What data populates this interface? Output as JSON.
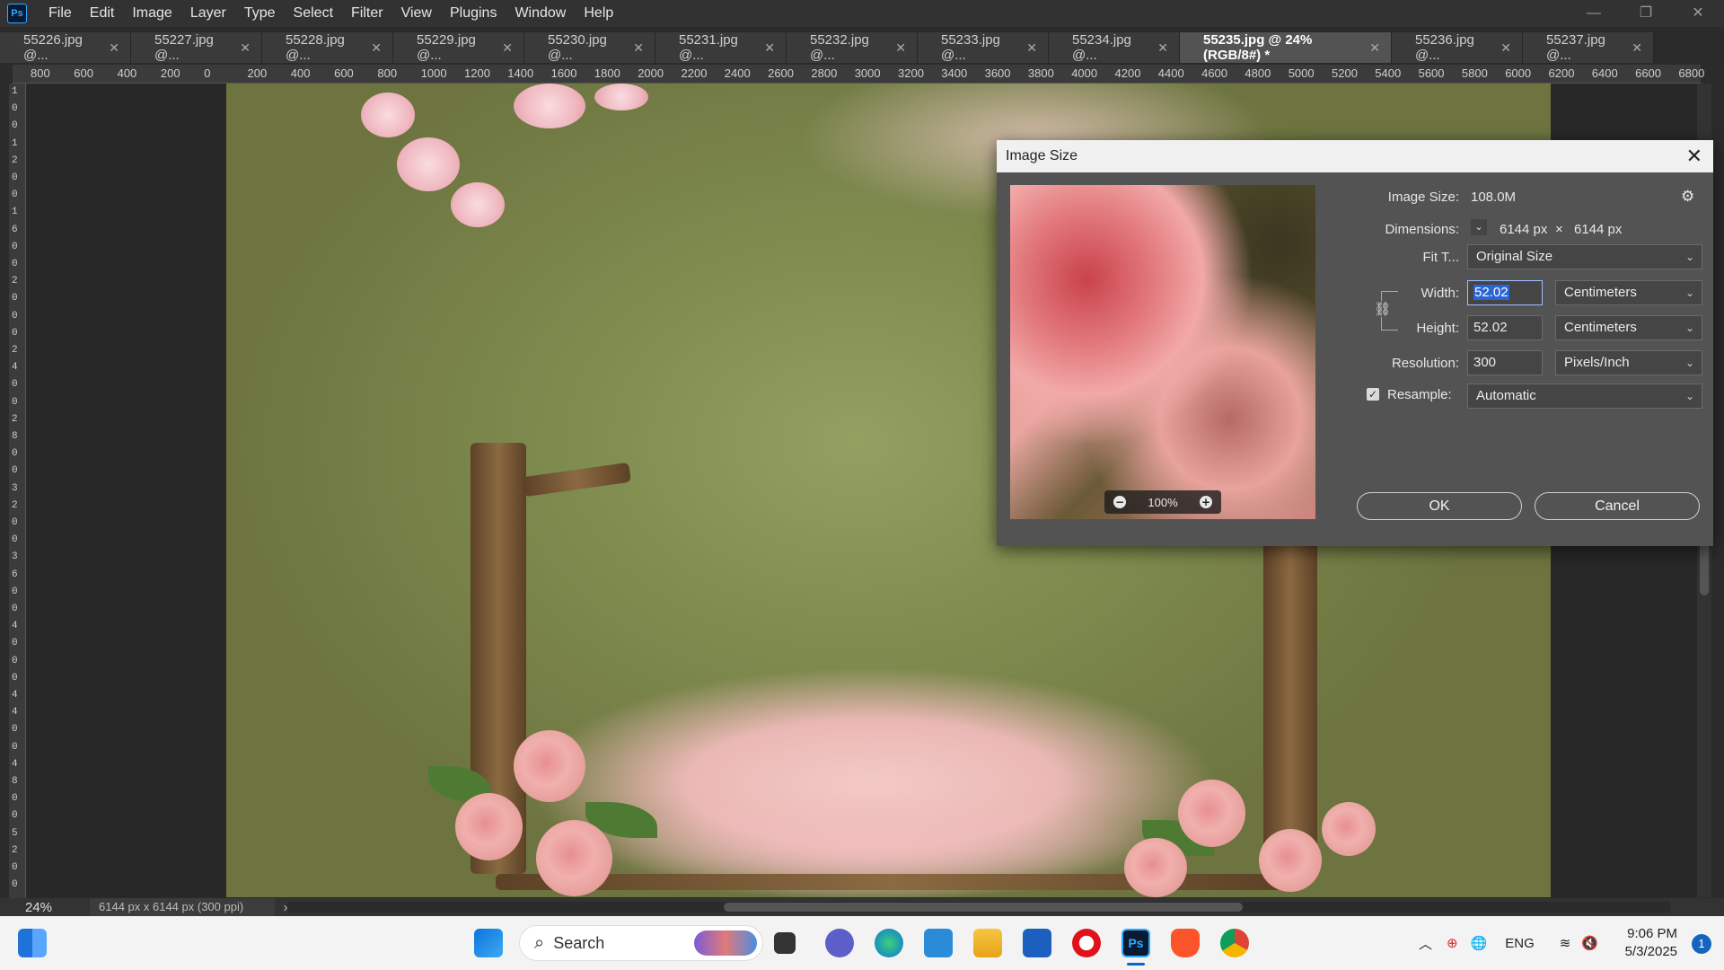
{
  "app": {
    "logo_text": "Ps",
    "menu": [
      "File",
      "Edit",
      "Image",
      "Layer",
      "Type",
      "Select",
      "Filter",
      "View",
      "Plugins",
      "Window",
      "Help"
    ],
    "window_controls": [
      "—",
      "❐",
      "✕"
    ]
  },
  "tabs": [
    {
      "label": "55226.jpg @...",
      "active": false
    },
    {
      "label": "55227.jpg @...",
      "active": false
    },
    {
      "label": "55228.jpg @...",
      "active": false
    },
    {
      "label": "55229.jpg @...",
      "active": false
    },
    {
      "label": "55230.jpg @...",
      "active": false
    },
    {
      "label": "55231.jpg @...",
      "active": false
    },
    {
      "label": "55232.jpg @...",
      "active": false
    },
    {
      "label": "55233.jpg @...",
      "active": false
    },
    {
      "label": "55234.jpg @...",
      "active": false
    },
    {
      "label": "55235.jpg @ 24% (RGB/8#) *",
      "active": true
    },
    {
      "label": "55236.jpg @...",
      "active": false
    },
    {
      "label": "55237.jpg @...",
      "active": false
    }
  ],
  "ruler": {
    "top_labels": [
      "800",
      "600",
      "400",
      "200",
      "0",
      "200",
      "400",
      "600",
      "800",
      "1000",
      "1200",
      "1400",
      "1600",
      "1800",
      "2000",
      "2200",
      "2400",
      "2600",
      "2800",
      "3000",
      "3200",
      "3400",
      "3600",
      "3800",
      "4000",
      "4200",
      "4400",
      "4600",
      "4800",
      "5000",
      "5200",
      "5400",
      "5600",
      "5800",
      "6000",
      "6200",
      "6400",
      "6600",
      "6800"
    ],
    "left_labels": [
      "1",
      "0",
      "0",
      "1",
      "2",
      "0",
      "0",
      "1",
      "6",
      "0",
      "0",
      "2",
      "0",
      "0",
      "0",
      "2",
      "4",
      "0",
      "0",
      "2",
      "8",
      "0",
      "0",
      "3",
      "2",
      "0",
      "0",
      "3",
      "6",
      "0",
      "0",
      "4",
      "0",
      "0",
      "0",
      "4",
      "4",
      "0",
      "0",
      "4",
      "8",
      "0",
      "0",
      "5",
      "2",
      "0",
      "0"
    ]
  },
  "status": {
    "zoom": "24%",
    "doc_info": "6144 px x 6144 px (300 ppi)",
    "arrow": "›"
  },
  "dialog": {
    "title": "Image Size",
    "close": "✕",
    "preview_zoom": "100%",
    "image_size_label": "Image Size:",
    "image_size_value": "108.0M",
    "dimensions_label": "Dimensions:",
    "dimensions_width": "6144 px",
    "dimensions_x": "×",
    "dimensions_height": "6144 px",
    "fit_label": "Fit T...",
    "fit_value": "Original Size",
    "width_label": "Width:",
    "width_value": "52.02",
    "width_unit": "Centimeters",
    "height_label": "Height:",
    "height_value": "52.02",
    "height_unit": "Centimeters",
    "resolution_label": "Resolution:",
    "resolution_value": "300",
    "resolution_unit": "Pixels/Inch",
    "resample_label": "Resample:",
    "resample_checked": true,
    "resample_value": "Automatic",
    "ok_label": "OK",
    "cancel_label": "Cancel"
  },
  "taskbar": {
    "search_label": "Search",
    "language": "ENG",
    "time": "9:06 PM",
    "date": "5/3/2025",
    "notification_count": "1",
    "apps": [
      "start-icon",
      "search-icon",
      "widgets-icon",
      "task-view-icon",
      "teams-icon",
      "edge-icon",
      "snipping-icon",
      "file-explorer-icon",
      "store-icon",
      "opera-icon",
      "photoshop-icon",
      "brave-icon",
      "chrome-icon"
    ]
  },
  "colors": {
    "accent": "#31a8ff",
    "dialog_bg": "#535353",
    "selection": "#2c63d6"
  }
}
